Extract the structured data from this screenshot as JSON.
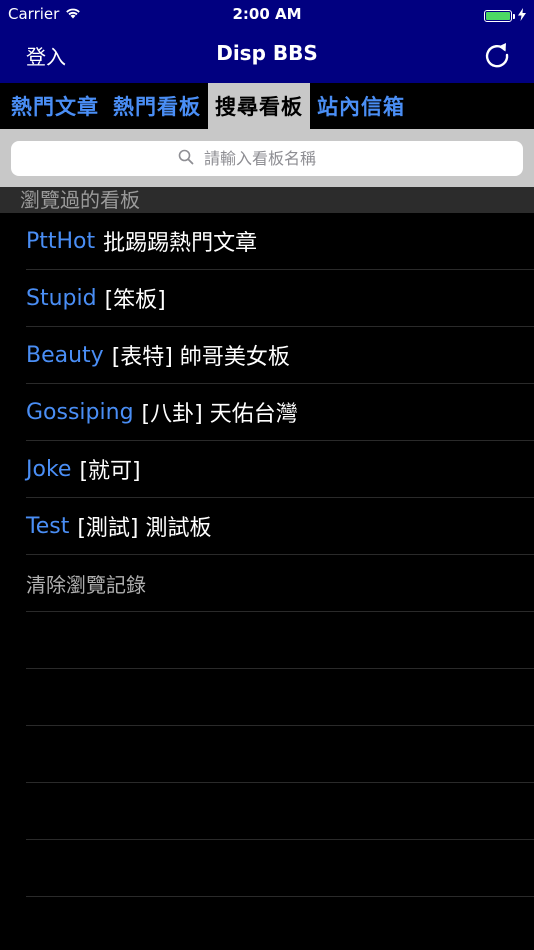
{
  "status_bar": {
    "carrier": "Carrier",
    "time": "2:00 AM",
    "battery_level": 1.0
  },
  "nav": {
    "left_label": "登入",
    "title": "Disp BBS"
  },
  "tabs": [
    {
      "label": "熱門文章"
    },
    {
      "label": "熱門看板"
    },
    {
      "label": "搜尋看板"
    },
    {
      "label": "站內信箱"
    }
  ],
  "active_tab": 2,
  "search": {
    "placeholder": "請輸入看板名稱"
  },
  "section": {
    "title": "瀏覽過的看板"
  },
  "boards": [
    {
      "name": "PttHot",
      "desc": "批踢踢熱門文章"
    },
    {
      "name": "Stupid",
      "desc": "[笨板]"
    },
    {
      "name": "Beauty",
      "desc": "[表特] 帥哥美女板"
    },
    {
      "name": "Gossiping",
      "desc": "[八卦] 天佑台灣"
    },
    {
      "name": "Joke",
      "desc": "[就可]"
    },
    {
      "name": "Test",
      "desc": "[測試] 測試板"
    }
  ],
  "clear_history_label": "清除瀏覽記錄",
  "colors": {
    "nav_background": "#010080",
    "accent": "#4a8ef5",
    "active_tab_background": "#c8c8c8",
    "battery": "#4cd964"
  },
  "icons": {
    "wifi": "wifi-icon",
    "refresh": "refresh-icon",
    "search": "search-icon",
    "charging": "charging-bolt-icon"
  }
}
